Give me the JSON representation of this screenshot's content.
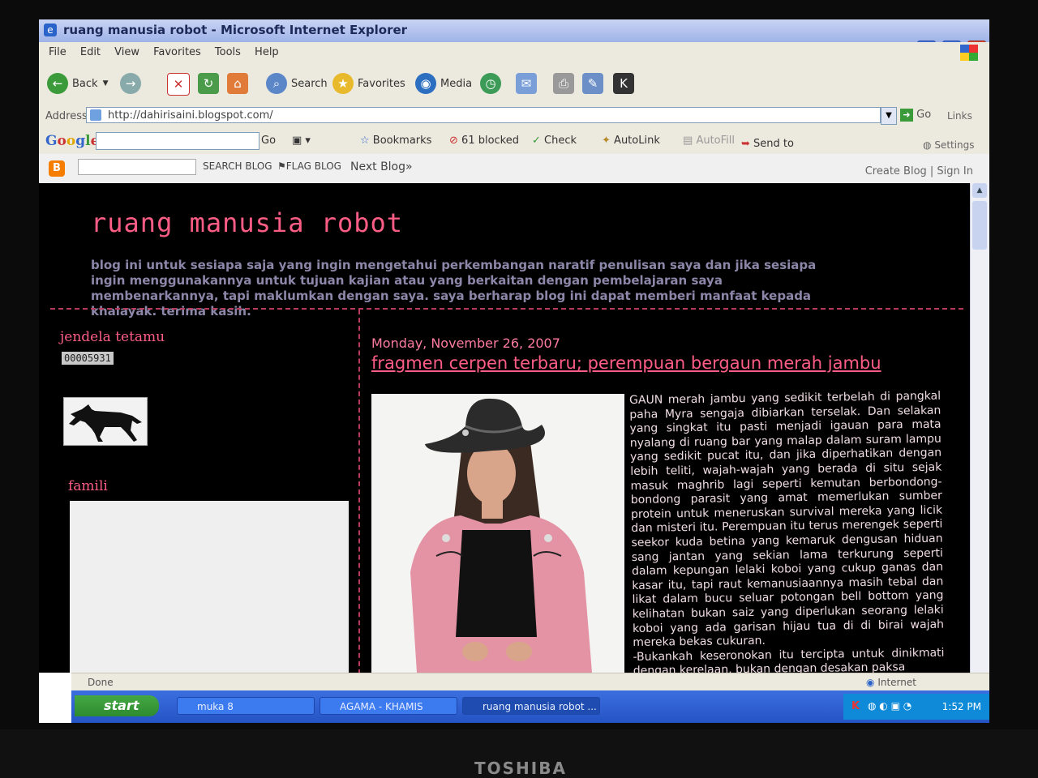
{
  "window": {
    "title": "ruang manusia robot - Microsoft Internet Explorer",
    "menu": [
      "File",
      "Edit",
      "View",
      "Favorites",
      "Tools",
      "Help"
    ]
  },
  "toolbar": {
    "back_label": "Back",
    "search_label": "Search",
    "favorites_label": "Favorites",
    "media_label": "Media"
  },
  "address": {
    "label": "Address",
    "url": "http://dahirisaini.blogspot.com/",
    "go_label": "Go",
    "links_label": "Links"
  },
  "google_toolbar": {
    "logo": "Google",
    "go_label": "Go",
    "bookmarks_label": "Bookmarks",
    "blocked_label": "61 blocked",
    "check_label": "Check",
    "autolink_label": "AutoLink",
    "autofill_label": "AutoFill",
    "sendto_label": "Send to",
    "settings_label": "Settings"
  },
  "blogger_bar": {
    "search_label": "SEARCH BLOG",
    "flag_label": "FLAG BLOG",
    "next_label": "Next Blog»",
    "create_label": "Create Blog | Sign In"
  },
  "blog": {
    "title": "ruang manusia robot",
    "description": "blog ini untuk sesiapa saja yang ingin mengetahui perkembangan naratif penulisan saya dan jika sesiapa ingin menggunakannya untuk tujuan kajian atau yang berkaitan dengan pembelajaran saya membenarkannya, tapi maklumkan dengan saya. saya berharap blog ini dapat memberi manfaat kepada khalayak. terima kasih."
  },
  "sidebar": {
    "visitor_heading": "jendela tetamu",
    "counter": "00005931",
    "famili_heading": "famili"
  },
  "post": {
    "date": "Monday, November 26, 2007",
    "title": "fragmen cerpen terbaru; perempuan bergaun merah jambu",
    "body": "GAUN merah jambu yang sedikit terbelah di pangkal paha Myra sengaja dibiarkan terselak. Dan selakan yang singkat itu pasti menjadi igauan para mata nyalang di ruang bar yang malap dalam suram lampu yang sedikit pucat itu, dan jika diperhatikan dengan lebih teliti, wajah-wajah yang berada di situ sejak masuk maghrib lagi seperti kemutan berbondong-bondong parasit yang amat memerlukan sumber protein untuk meneruskan survival mereka yang licik dan misteri itu. Perempuan itu terus merengek seperti seekor kuda betina yang kemaruk dengusan hiduan sang jantan yang sekian lama terkurung seperti dalam kepungan lelaki koboi yang cukup ganas dan kasar itu, tapi raut kemanusiaannya masih tebal dan likat dalam bucu seluar potongan bell bottom yang kelihatan bukan saiz yang diperlukan seorang lelaki koboi yang ada garisan hijau tua di di birai wajah mereka bekas cukuran.",
    "body2": "-Bukankah keseronokan itu tercipta untuk dinikmati dengan kerelaan, bukan dengan desakan paksa"
  },
  "status": {
    "done": "Done",
    "zone": "Internet"
  },
  "taskbar": {
    "start": "start",
    "tasks": [
      "muka 8",
      "AGAMA - KHAMIS",
      "ruang manusia robot ..."
    ],
    "clock": "1:52 PM"
  },
  "monitor": {
    "brand": "TOSHIBA"
  },
  "colors": {
    "accent_pink": "#ff5d86",
    "blog_bg": "#000000",
    "desc_gray": "#8d86a8"
  }
}
